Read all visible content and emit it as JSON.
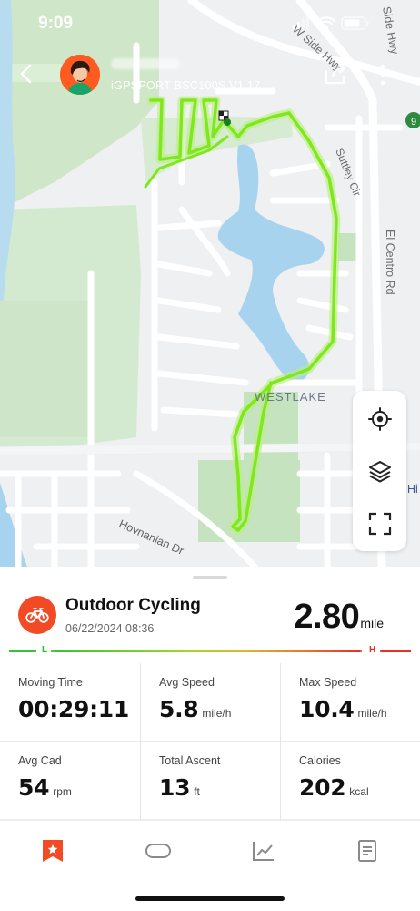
{
  "status_bar": {
    "time": "9:09"
  },
  "header": {
    "device_name": "iGPSPORT BSC100S V1.17",
    "icons": [
      "back-icon",
      "share-icon",
      "more-icon"
    ]
  },
  "map": {
    "street_labels": [
      {
        "name": "W Side Hwy"
      },
      {
        "name": "Side Hwy"
      },
      {
        "name": "Suttley Cir"
      },
      {
        "name": "El Centro Rd"
      },
      {
        "name": "WESTLAKE"
      },
      {
        "name": "Hovnanian Dr"
      },
      {
        "name": "Hi"
      },
      {
        "name": "9"
      }
    ],
    "tools": [
      "locate-icon",
      "layers-icon",
      "fullscreen-icon"
    ]
  },
  "activity": {
    "type": "Outdoor Cycling",
    "date": "06/22/2024 08:36",
    "distance": "2.80",
    "distance_unit": "mile",
    "legend_low": "L",
    "legend_high": "H"
  },
  "stats": [
    [
      {
        "label": "Moving Time",
        "value": "00:29:11",
        "unit": ""
      },
      {
        "label": "Avg Speed",
        "value": "5.8",
        "unit": "mile/h"
      },
      {
        "label": "Max Speed",
        "value": "10.4",
        "unit": "mile/h"
      }
    ],
    [
      {
        "label": "Avg Cad",
        "value": "54",
        "unit": "rpm"
      },
      {
        "label": "Total Ascent",
        "value": "13",
        "unit": "ft"
      },
      {
        "label": "Calories",
        "value": "202",
        "unit": "kcal"
      }
    ]
  ],
  "tabs": [
    {
      "name": "summary-tab-icon",
      "active": true
    },
    {
      "name": "laps-tab-icon",
      "active": false
    },
    {
      "name": "chart-tab-icon",
      "active": false
    },
    {
      "name": "details-tab-icon",
      "active": false
    }
  ],
  "colors": {
    "accent": "#f24a24",
    "route": "#7ee81c",
    "water": "#a8d3ef",
    "park": "#c6e5c1"
  }
}
